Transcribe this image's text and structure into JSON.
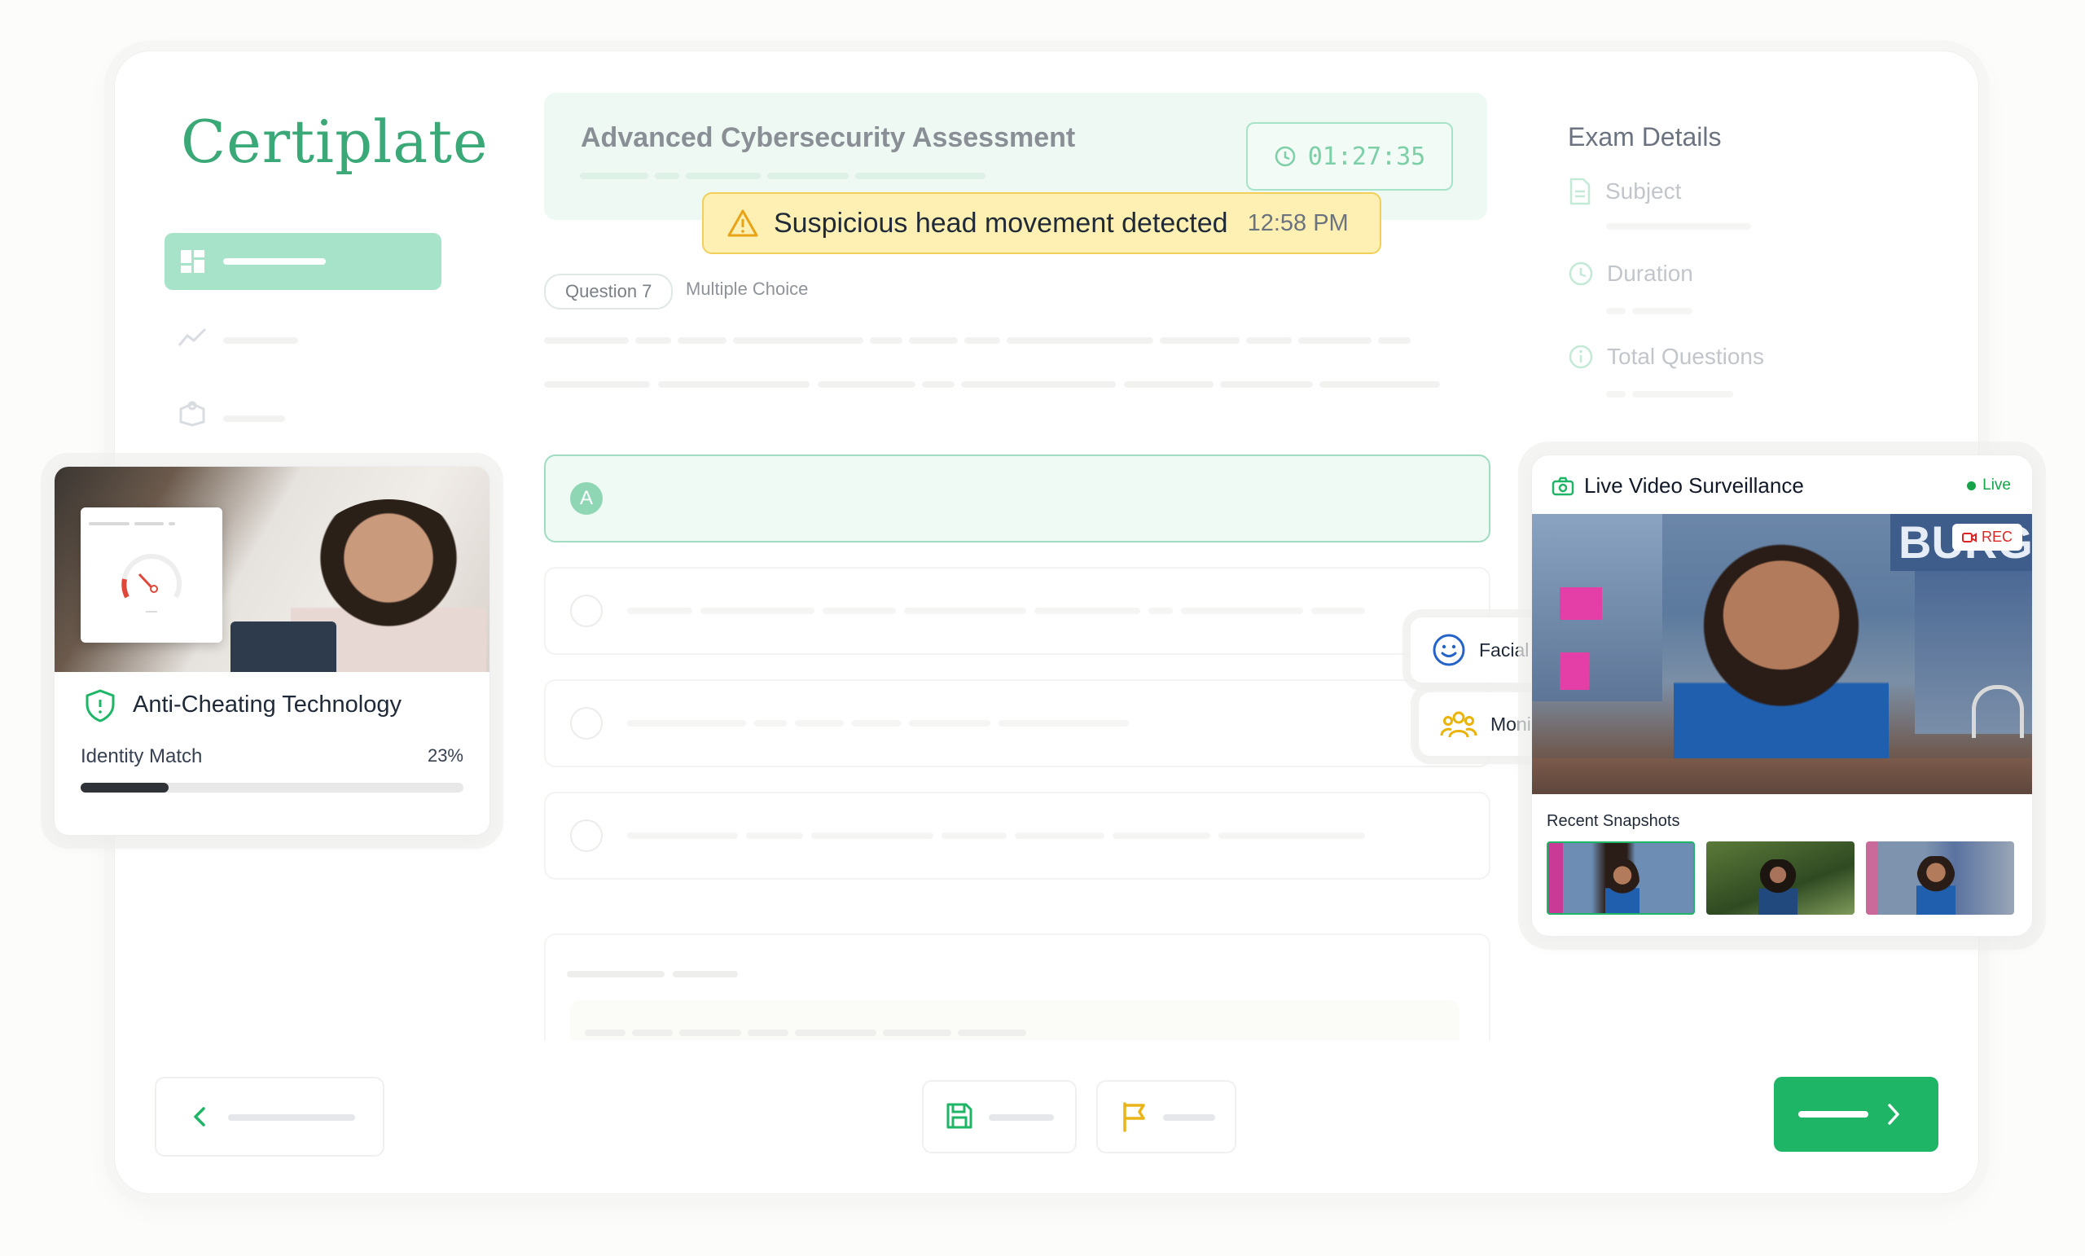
{
  "brand": {
    "logo_text": "Certiplate"
  },
  "exam": {
    "title": "Advanced Cybersecurity Assessment",
    "timer": "01:27:35",
    "question_label": "Question 7",
    "question_type": "Multiple Choice",
    "options": [
      {
        "letter": "A",
        "selected": true
      },
      {
        "letter": "",
        "selected": false
      },
      {
        "letter": "",
        "selected": false
      },
      {
        "letter": "",
        "selected": false
      }
    ]
  },
  "alert": {
    "message": "Suspicious head movement detected",
    "time": "12:58 PM",
    "icon": "warning-triangle-icon"
  },
  "exam_details": {
    "title": "Exam Details",
    "rows": [
      {
        "label": "Subject",
        "icon": "document-icon"
      },
      {
        "label": "Duration",
        "icon": "clock-icon"
      },
      {
        "label": "Total Questions",
        "icon": "info-icon"
      }
    ]
  },
  "anti_cheat": {
    "title": "Anti-Cheating Technology",
    "identity_label": "Identity Match",
    "identity_value": "23%",
    "identity_fraction": 0.23
  },
  "surveillance": {
    "title": "Live Video Surveillance",
    "status": "Live",
    "rec_label": "REC",
    "snapshots_label": "Recent Snapshots",
    "video_sign_text": "BURG"
  },
  "features": [
    {
      "label": "Facial recognition",
      "icon": "smiley-face-icon"
    },
    {
      "label": "Monitor candidates",
      "icon": "users-group-icon"
    }
  ],
  "colors": {
    "brand_green": "#1fb566",
    "accent_mint": "#a6e3c8",
    "alert_yellow": "#fdf0b2",
    "live_green": "#16a34a",
    "rec_red": "#dc2626"
  }
}
